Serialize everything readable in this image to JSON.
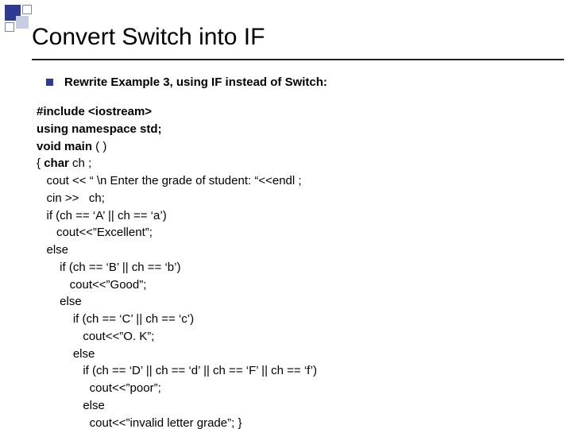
{
  "title": "Convert Switch into IF",
  "bullet": "Rewrite Example 3, using IF instead of Switch:",
  "code": {
    "l0": "#include <iostream>",
    "l1": "using namespace std;",
    "l2a": "void main",
    "l2b": " ( )",
    "l3a": "{ ",
    "l3b": "char",
    "l3c": " ch ;",
    "l4": "   cout << “ \\n Enter the grade of student: “<<endl ;",
    "l5": "   cin >>   ch;",
    "l6": "   if (ch == ‘A’ || ch == ‘a’)",
    "l7": "      cout<<”Excellent”;",
    "l8": "   else",
    "l9": "       if (ch == ‘B’ || ch == ‘b’)",
    "l10": "          cout<<”Good”;",
    "l11": "       else",
    "l12": "           if (ch == ‘C’ || ch == ‘c’)",
    "l13": "              cout<<”O. K”;",
    "l14": "           else",
    "l15": "              if (ch == ‘D’ || ch == ‘d’ || ch == ‘F’ || ch == ‘f’)",
    "l16": "                cout<<”poor”;",
    "l17": "              else\n                cout<<”invalid letter grade”; }"
  }
}
